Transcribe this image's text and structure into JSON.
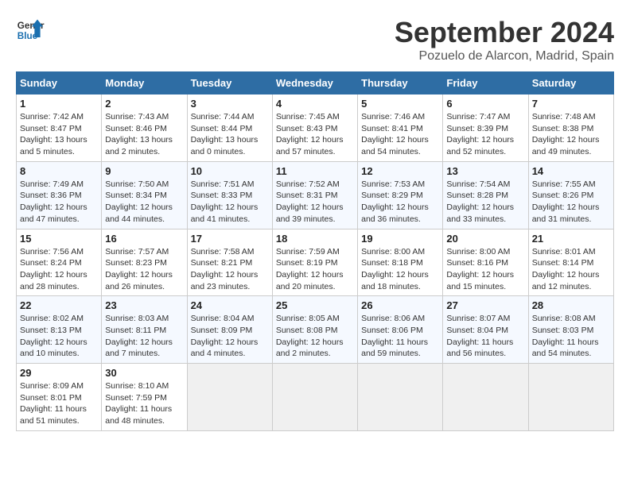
{
  "logo": {
    "line1": "General",
    "line2": "Blue"
  },
  "title": "September 2024",
  "location": "Pozuelo de Alarcon, Madrid, Spain",
  "weekdays": [
    "Sunday",
    "Monday",
    "Tuesday",
    "Wednesday",
    "Thursday",
    "Friday",
    "Saturday"
  ],
  "weeks": [
    [
      {
        "day": "1",
        "sunrise": "7:42 AM",
        "sunset": "8:47 PM",
        "daylight": "13 hours and 5 minutes."
      },
      {
        "day": "2",
        "sunrise": "7:43 AM",
        "sunset": "8:46 PM",
        "daylight": "13 hours and 2 minutes."
      },
      {
        "day": "3",
        "sunrise": "7:44 AM",
        "sunset": "8:44 PM",
        "daylight": "13 hours and 0 minutes."
      },
      {
        "day": "4",
        "sunrise": "7:45 AM",
        "sunset": "8:43 PM",
        "daylight": "12 hours and 57 minutes."
      },
      {
        "day": "5",
        "sunrise": "7:46 AM",
        "sunset": "8:41 PM",
        "daylight": "12 hours and 54 minutes."
      },
      {
        "day": "6",
        "sunrise": "7:47 AM",
        "sunset": "8:39 PM",
        "daylight": "12 hours and 52 minutes."
      },
      {
        "day": "7",
        "sunrise": "7:48 AM",
        "sunset": "8:38 PM",
        "daylight": "12 hours and 49 minutes."
      }
    ],
    [
      {
        "day": "8",
        "sunrise": "7:49 AM",
        "sunset": "8:36 PM",
        "daylight": "12 hours and 47 minutes."
      },
      {
        "day": "9",
        "sunrise": "7:50 AM",
        "sunset": "8:34 PM",
        "daylight": "12 hours and 44 minutes."
      },
      {
        "day": "10",
        "sunrise": "7:51 AM",
        "sunset": "8:33 PM",
        "daylight": "12 hours and 41 minutes."
      },
      {
        "day": "11",
        "sunrise": "7:52 AM",
        "sunset": "8:31 PM",
        "daylight": "12 hours and 39 minutes."
      },
      {
        "day": "12",
        "sunrise": "7:53 AM",
        "sunset": "8:29 PM",
        "daylight": "12 hours and 36 minutes."
      },
      {
        "day": "13",
        "sunrise": "7:54 AM",
        "sunset": "8:28 PM",
        "daylight": "12 hours and 33 minutes."
      },
      {
        "day": "14",
        "sunrise": "7:55 AM",
        "sunset": "8:26 PM",
        "daylight": "12 hours and 31 minutes."
      }
    ],
    [
      {
        "day": "15",
        "sunrise": "7:56 AM",
        "sunset": "8:24 PM",
        "daylight": "12 hours and 28 minutes."
      },
      {
        "day": "16",
        "sunrise": "7:57 AM",
        "sunset": "8:23 PM",
        "daylight": "12 hours and 26 minutes."
      },
      {
        "day": "17",
        "sunrise": "7:58 AM",
        "sunset": "8:21 PM",
        "daylight": "12 hours and 23 minutes."
      },
      {
        "day": "18",
        "sunrise": "7:59 AM",
        "sunset": "8:19 PM",
        "daylight": "12 hours and 20 minutes."
      },
      {
        "day": "19",
        "sunrise": "8:00 AM",
        "sunset": "8:18 PM",
        "daylight": "12 hours and 18 minutes."
      },
      {
        "day": "20",
        "sunrise": "8:00 AM",
        "sunset": "8:16 PM",
        "daylight": "12 hours and 15 minutes."
      },
      {
        "day": "21",
        "sunrise": "8:01 AM",
        "sunset": "8:14 PM",
        "daylight": "12 hours and 12 minutes."
      }
    ],
    [
      {
        "day": "22",
        "sunrise": "8:02 AM",
        "sunset": "8:13 PM",
        "daylight": "12 hours and 10 minutes."
      },
      {
        "day": "23",
        "sunrise": "8:03 AM",
        "sunset": "8:11 PM",
        "daylight": "12 hours and 7 minutes."
      },
      {
        "day": "24",
        "sunrise": "8:04 AM",
        "sunset": "8:09 PM",
        "daylight": "12 hours and 4 minutes."
      },
      {
        "day": "25",
        "sunrise": "8:05 AM",
        "sunset": "8:08 PM",
        "daylight": "12 hours and 2 minutes."
      },
      {
        "day": "26",
        "sunrise": "8:06 AM",
        "sunset": "8:06 PM",
        "daylight": "11 hours and 59 minutes."
      },
      {
        "day": "27",
        "sunrise": "8:07 AM",
        "sunset": "8:04 PM",
        "daylight": "11 hours and 56 minutes."
      },
      {
        "day": "28",
        "sunrise": "8:08 AM",
        "sunset": "8:03 PM",
        "daylight": "11 hours and 54 minutes."
      }
    ],
    [
      {
        "day": "29",
        "sunrise": "8:09 AM",
        "sunset": "8:01 PM",
        "daylight": "11 hours and 51 minutes."
      },
      {
        "day": "30",
        "sunrise": "8:10 AM",
        "sunset": "7:59 PM",
        "daylight": "11 hours and 48 minutes."
      },
      null,
      null,
      null,
      null,
      null
    ]
  ]
}
